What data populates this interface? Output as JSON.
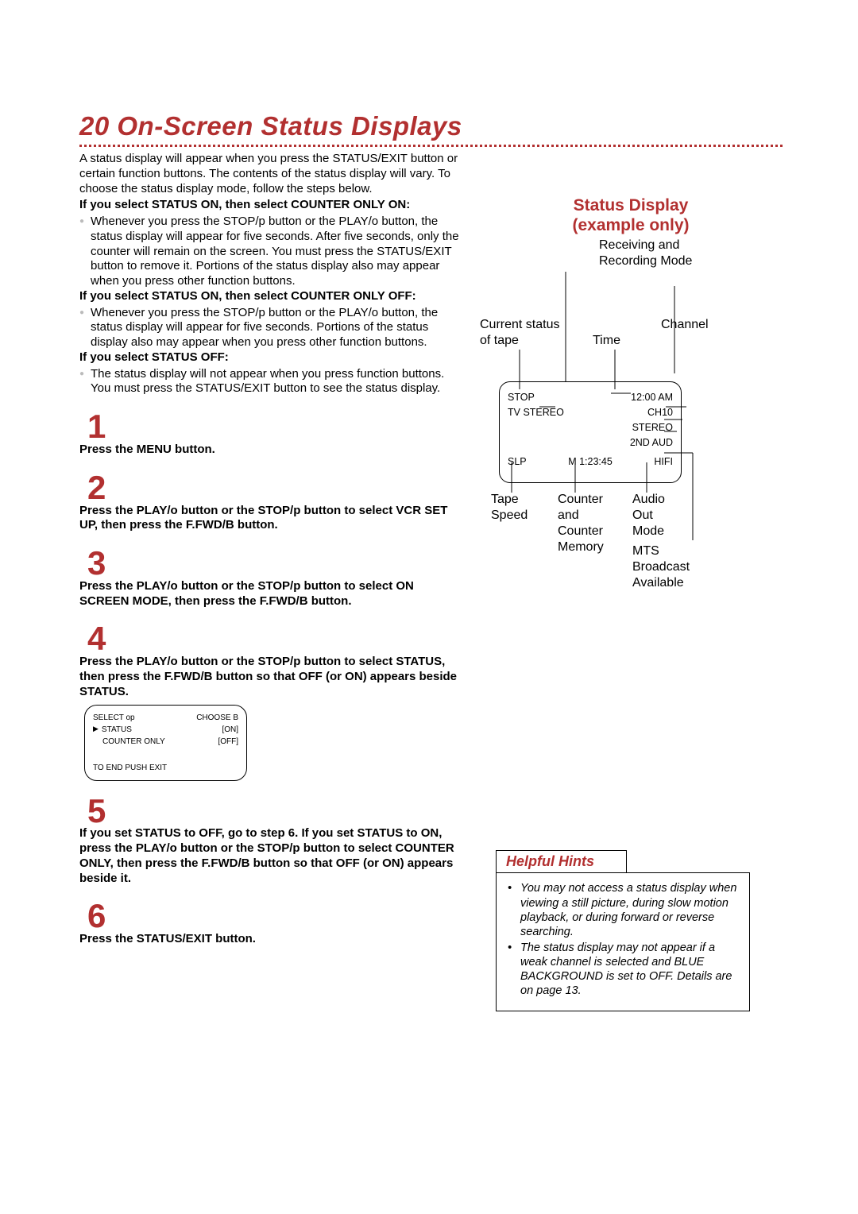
{
  "title_number": "20",
  "title_text": "On-Screen Status Displays",
  "intro": "A status display will appear when you press the STATUS/EXIT button or certain function buttons. The contents of the status display will vary. To choose the status display mode, follow the steps below.",
  "cond1_head": "If you select STATUS ON, then select COUNTER ONLY ON:",
  "cond1_body": "Whenever you press the STOP/p button or the PLAY/o button, the status display will appear for five seconds. After five seconds, only the counter will remain on the screen. You must press the STATUS/EXIT button to remove it. Portions of the status display also may appear when you press other function buttons.",
  "cond2_head": "If you select STATUS ON, then select COUNTER ONLY OFF:",
  "cond2_body": "Whenever you press the STOP/p button or the PLAY/o button, the status display will appear for five seconds. Portions of the status display also may appear when you press other function buttons.",
  "cond3_head": "If you select STATUS OFF:",
  "cond3_body": "The status display will not appear when you press function buttons. You must press the STATUS/EXIT button to see the status display.",
  "steps": {
    "s1": "Press the MENU button.",
    "s2": "Press the PLAY/o button or the STOP/p button to select VCR SET UP, then press the F.FWD/B button.",
    "s3": "Press the PLAY/o button or the STOP/p button to select ON SCREEN MODE, then press the F.FWD/B button.",
    "s4": "Press the PLAY/o button or the STOP/p button to select STATUS, then press the F.FWD/B button so that OFF (or ON) appears beside STATUS.",
    "s5": "If you set STATUS to OFF, go to step 6. If you set STATUS to ON, press the PLAY/o button or the STOP/p button to select COUNTER ONLY, then press the F.FWD/B button so that OFF (or ON) appears beside it.",
    "s6": "Press the STATUS/EXIT button."
  },
  "screenbox": {
    "header_l": "SELECT op",
    "header_r": "CHOOSE B",
    "row1_l": "STATUS",
    "row1_r": "[ON]",
    "row2_l": "COUNTER ONLY",
    "row2_r": "[OFF]",
    "footer": "TO END PUSH EXIT"
  },
  "sd_title_1": "Status Display",
  "sd_title_2": "(example only)",
  "labels": {
    "receiving": "Receiving and",
    "recording": "Recording Mode",
    "current1": "Current status",
    "current2": "of tape",
    "channel": "Channel",
    "time": "Time",
    "tape1": "Tape",
    "tape2": "Speed",
    "counter1": "Counter",
    "counter2": "and",
    "counter3": "Counter",
    "counter4": "Memory",
    "audio1": "Audio",
    "audio2": "Out",
    "audio3": "Mode",
    "mts1": "MTS",
    "mts2": "Broadcast",
    "mts3": "Available"
  },
  "osd": {
    "r1_l": "STOP",
    "r1_r": "12:00 AM",
    "r2_l": "TV STEREO",
    "r2_r1": "CH10",
    "r2_r2": "STEREO",
    "r2_r3": "2ND AUD",
    "r3_l": "SLP",
    "r3_m": "M  1:23:45",
    "r3_r": "HIFI"
  },
  "hints_title": "Helpful Hints",
  "hints": [
    "You may not access a status display when viewing a still picture, during slow motion playback, or during forward or reverse searching.",
    "The status display may not appear if a weak channel is selected and BLUE BACKGROUND is set to OFF. Details are on page 13."
  ]
}
